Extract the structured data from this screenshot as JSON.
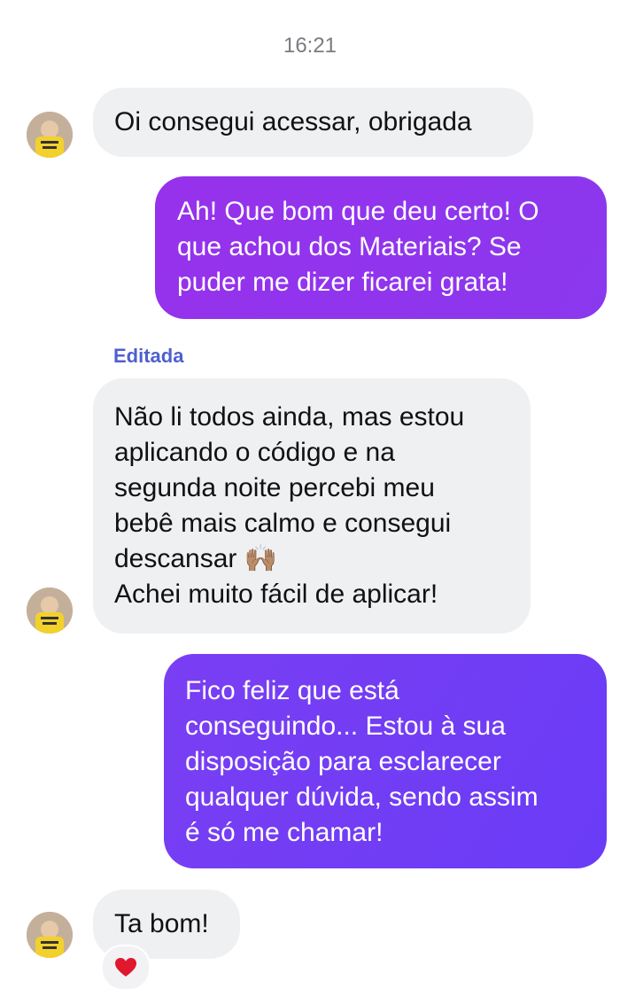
{
  "timestamp": "16:21",
  "messages": [
    {
      "from": "contact",
      "text": "Oi consegui acessar, obrigada"
    },
    {
      "from": "me",
      "text": "Ah! Que bom que deu certo! O\nque achou dos Materiais? Se\npuder me dizer ficarei grata!"
    },
    {
      "from": "contact",
      "edited_label": "Editada",
      "text": "Não li todos ainda, mas estou\naplicando o código e na\nsegunda noite percebi meu\nbebê mais calmo e consegui\ndescansar 🙌🏽\nAchei muito fácil de aplicar!"
    },
    {
      "from": "me",
      "text": "Fico feliz que está\nconseguindo... Estou à sua\ndisposição para esclarecer\nqualquer dúvida, sendo assim\né só me chamar!"
    },
    {
      "from": "contact",
      "text": "Ta bom!",
      "reaction": "heart-icon"
    }
  ],
  "colors": {
    "incoming_bubble": "#eff0f2",
    "outgoing_gradient_1": "#9333ea",
    "outgoing_gradient_2": "#6d3df5",
    "edited_label": "#4f5fcf",
    "reaction_heart": "#e0182d"
  }
}
